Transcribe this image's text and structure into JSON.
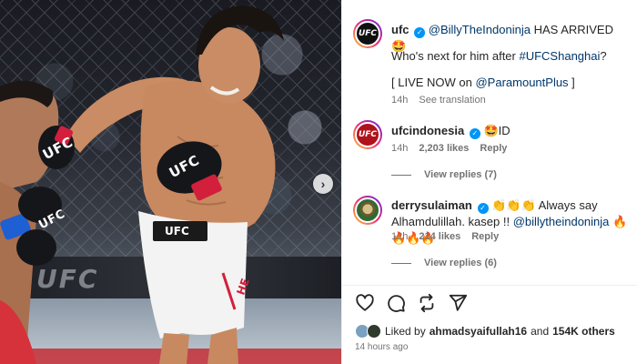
{
  "photo": {
    "banner_text": "UFC",
    "glove_left_label": "UFC",
    "glove_right_label": "UFC",
    "shorts_label": "UFC",
    "shorts_side_text": "HE",
    "next_icon": "chevron-right-icon"
  },
  "post": {
    "author": "ufc",
    "avatar_text": "UFC",
    "mention": "@BillyTheIndoninja",
    "caption_rest": " HAS ARRIVED 🤩",
    "question_pre": "Who's next for him after ",
    "hashtag": "#UFCShanghai",
    "question_post": "?",
    "live_pre": "[ LIVE NOW on ",
    "live_link": "@ParamountPlus",
    "live_post": " ]",
    "time": "14h",
    "see_translation": "See translation"
  },
  "comments": [
    {
      "username": "ufcindonesia",
      "avatar_text": "UFC",
      "text": "🤩ID",
      "time": "14h",
      "likes": "2,203 likes",
      "reply": "Reply",
      "view_replies": "View replies (7)"
    },
    {
      "username": "derrysulaiman",
      "text_pre": "👏👏👏 Always say Alhamdulillah. kasep !! ",
      "mention": "@billytheindoninja",
      "text_post": " 🔥🔥🔥🔥",
      "time": "12h",
      "likes": "214 likes",
      "reply": "Reply",
      "view_replies": "View replies (6)"
    }
  ],
  "footer": {
    "liked_by_prefix": "Liked by ",
    "liked_by_user": "ahmadsyaifullah16",
    "and": " and ",
    "others": "154K others",
    "timestamp": "14 hours ago"
  },
  "colors": {
    "verified": "#0095f6",
    "link": "#00376b",
    "muted": "#737373",
    "glove_red": "#d21f3c"
  }
}
